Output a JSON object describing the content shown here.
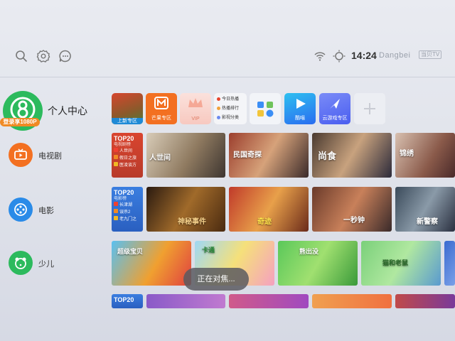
{
  "topbar": {
    "time": "14:24",
    "brand": "Dangbei",
    "brand_tag": "当贝TV"
  },
  "sidebar": {
    "profile_title": "个人中心",
    "login_badge": "登录享1080P",
    "items": [
      {
        "label": "电视剧",
        "color": "#f37021",
        "icon": "tv-icon"
      },
      {
        "label": "电影",
        "color": "#2a8be8",
        "icon": "film-reel-icon"
      },
      {
        "label": "少儿",
        "color": "#2cba5d",
        "icon": "bear-icon"
      }
    ]
  },
  "apps": [
    {
      "label": "上新专区"
    },
    {
      "label": "芒果专区"
    },
    {
      "label": "VIP"
    },
    {
      "news": [
        "今日热播",
        "热播排行",
        "影视分类"
      ]
    },
    {
      "label": ""
    },
    {
      "label": "酷喵"
    },
    {
      "label": "云游戏专区"
    },
    {
      "label": ""
    }
  ],
  "rows": {
    "tv": {
      "top20_title": "TOP20",
      "top20_sub": "电视剧榜",
      "top20_items": [
        "人世间",
        "假日之旅",
        "医凌谈方"
      ],
      "cards": [
        "人世间",
        "民国奇探",
        "尚食",
        "锦绣"
      ]
    },
    "movie": {
      "top20_title": "TOP20",
      "top20_sub": "电影榜",
      "top20_items": [
        "长津湖",
        "误杀2",
        "老九门之"
      ],
      "cards": [
        "神秘事件",
        "奇迹",
        "一秒钟",
        "新警察"
      ]
    },
    "kids": {
      "cards": [
        "超级宝贝",
        "卡通",
        "熊出没",
        "猫和老鼠"
      ]
    },
    "partial": {
      "top20_title": "TOP20"
    }
  },
  "toast": "正在对焦..."
}
